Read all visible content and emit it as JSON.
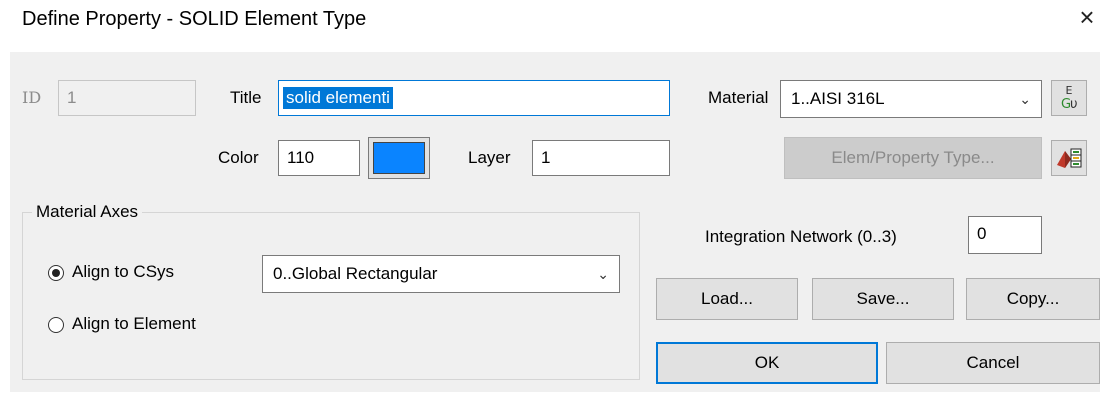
{
  "window": {
    "title": "Define Property - SOLID Element Type",
    "close_glyph": "×"
  },
  "id": {
    "label": "ID",
    "value": "1"
  },
  "title_field": {
    "label": "Title",
    "value": "solid elementi"
  },
  "material": {
    "label": "Material",
    "value": "1..AISI 316L"
  },
  "color": {
    "label": "Color",
    "value": "110",
    "swatch": "#0a84ff"
  },
  "layer": {
    "label": "Layer",
    "value": "1"
  },
  "elem_type_button": "Elem/Property Type...",
  "material_axes": {
    "group_label": "Material Axes",
    "align_csys": "Align to CSys",
    "align_element": "Align to Element",
    "csys_value": "0..Global Rectangular",
    "selected": "align_csys"
  },
  "integration": {
    "label": "Integration Network (0..3)",
    "value": "0"
  },
  "buttons": {
    "load": "Load...",
    "save": "Save...",
    "copy": "Copy...",
    "ok": "OK",
    "cancel": "Cancel"
  },
  "icons": {
    "material_icon": "material-library-icon",
    "elem_icon": "element-type-icon"
  }
}
